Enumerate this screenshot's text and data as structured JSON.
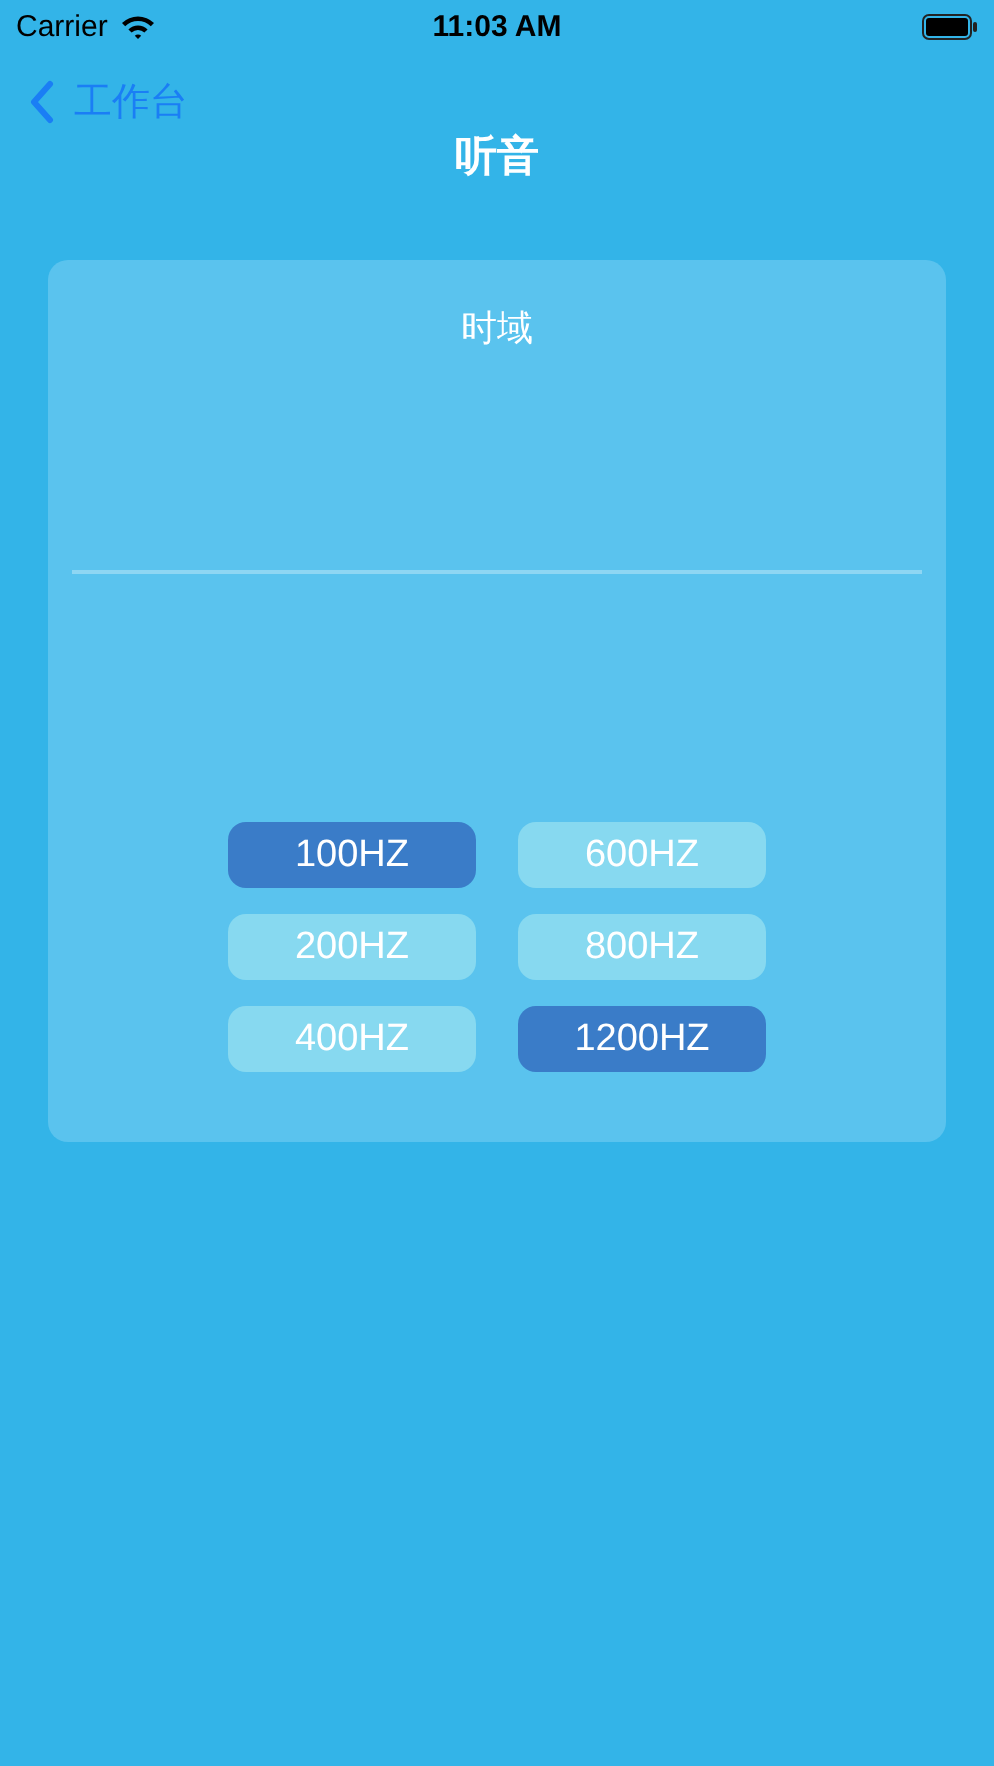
{
  "status_bar": {
    "carrier": "Carrier",
    "time": "11:03 AM"
  },
  "nav": {
    "back_label": "工作台",
    "title": "听音"
  },
  "card": {
    "title": "时域",
    "buttons": [
      {
        "label": "100HZ",
        "selected": true
      },
      {
        "label": "600HZ",
        "selected": false
      },
      {
        "label": "200HZ",
        "selected": false
      },
      {
        "label": "800HZ",
        "selected": false
      },
      {
        "label": "400HZ",
        "selected": false
      },
      {
        "label": "1200HZ",
        "selected": true
      }
    ]
  }
}
